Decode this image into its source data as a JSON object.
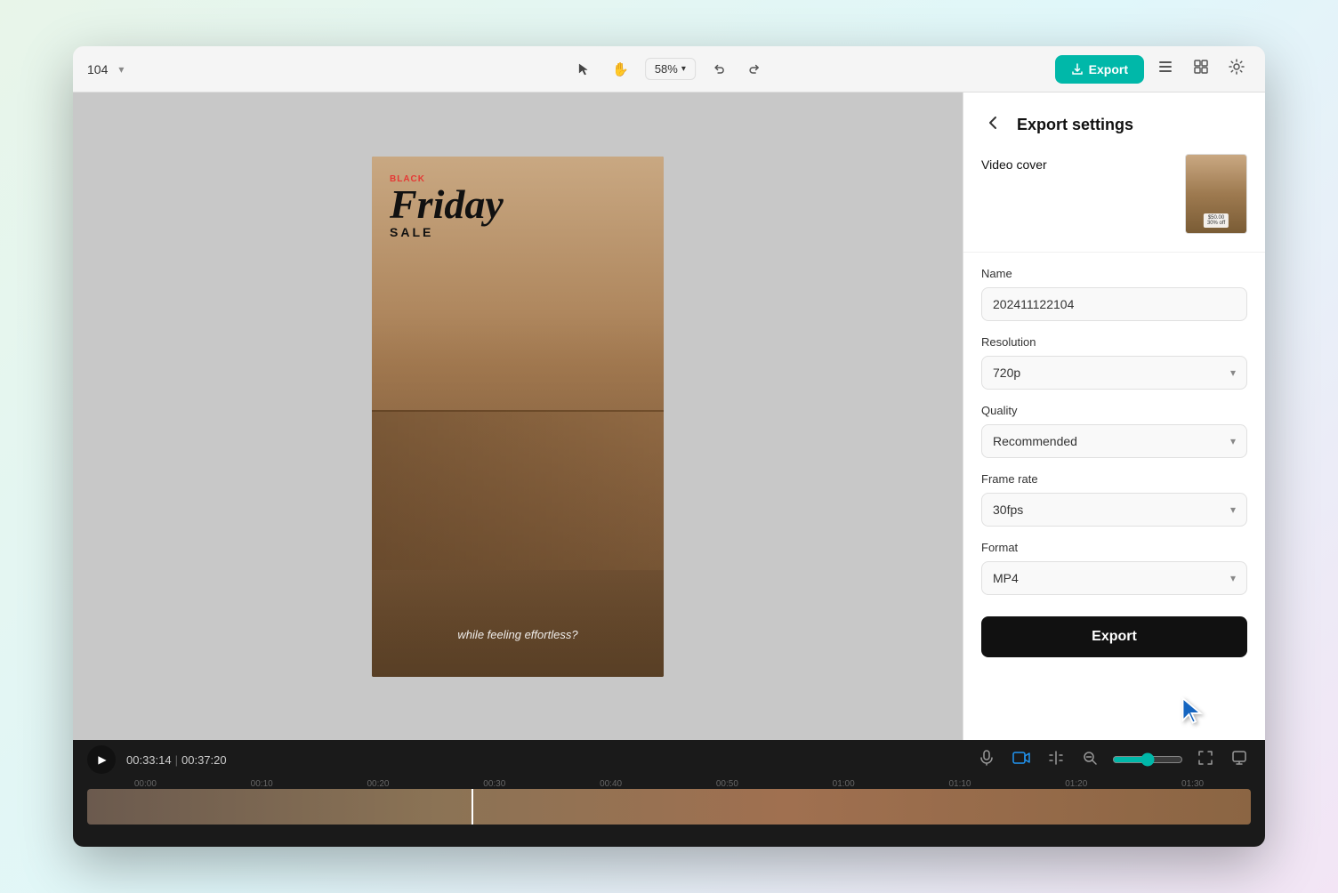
{
  "topbar": {
    "title": "104",
    "zoom_label": "58%",
    "export_label": "Export",
    "tools": {
      "select": "▶",
      "hand": "✋",
      "undo": "↩",
      "redo": "↪"
    }
  },
  "canvas": {
    "video": {
      "title_black": "BLACK",
      "title_red": "BLACK",
      "friday_text": "Friday",
      "sale_text": "SALE",
      "bottom_text": "while feeling effortless?"
    }
  },
  "export_panel": {
    "back_label": "‹",
    "title": "Export settings",
    "video_cover_label": "Video cover",
    "name_label": "Name",
    "name_value": "202411122104",
    "resolution_label": "Resolution",
    "resolution_value": "720p",
    "quality_label": "Quality",
    "quality_value": "Recommended",
    "frame_rate_label": "Frame rate",
    "frame_rate_value": "30fps",
    "format_label": "Format",
    "format_value": "MP4",
    "export_btn_label": "Export",
    "cover_price": "$50.00\n30% off"
  },
  "timeline": {
    "play_icon": "▶",
    "current_time": "00:33:14",
    "total_time": "00:37:20",
    "ruler_marks": [
      "00:00",
      "00:10",
      "00:20",
      "00:30",
      "00:40",
      "00:50",
      "01:00",
      "01:10",
      "01:20",
      "01:30"
    ]
  }
}
